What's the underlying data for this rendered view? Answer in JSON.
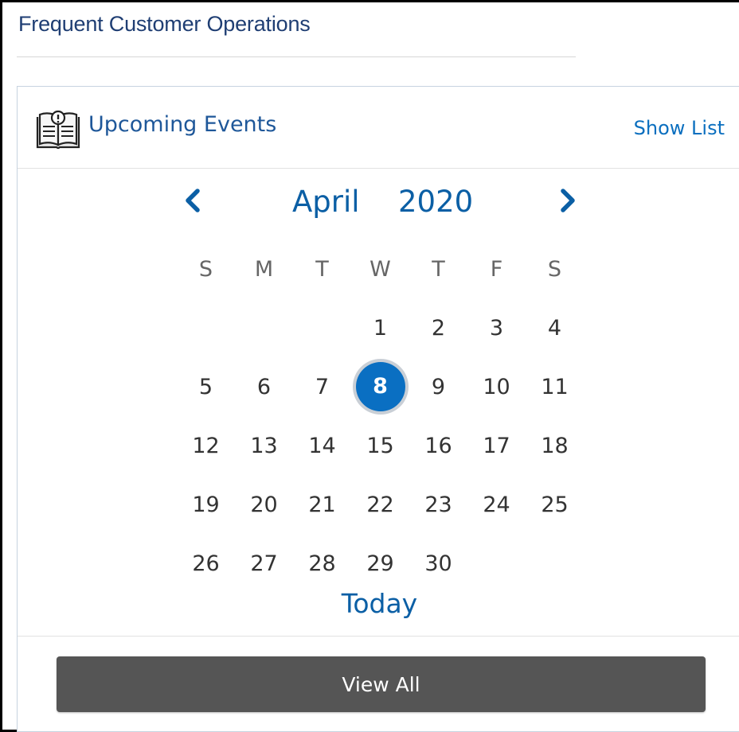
{
  "page": {
    "title": "Frequent Customer Operations"
  },
  "widget": {
    "icon": "book-info-icon",
    "title": "Upcoming Events",
    "show_list_label": "Show List"
  },
  "calendar": {
    "month": "April",
    "year": "2020",
    "prev_icon": "chevron-left-icon",
    "next_icon": "chevron-right-icon",
    "weekdays": [
      "S",
      "M",
      "T",
      "W",
      "T",
      "F",
      "S"
    ],
    "weeks": [
      [
        "",
        "",
        "",
        "1",
        "2",
        "3",
        "4"
      ],
      [
        "5",
        "6",
        "7",
        "8",
        "9",
        "10",
        "11"
      ],
      [
        "12",
        "13",
        "14",
        "15",
        "16",
        "17",
        "18"
      ],
      [
        "19",
        "20",
        "21",
        "22",
        "23",
        "24",
        "25"
      ],
      [
        "26",
        "27",
        "28",
        "29",
        "30",
        "",
        ""
      ]
    ],
    "selected_day": "8",
    "today_label": "Today",
    "accent_color": "#0a6fc2"
  },
  "footer": {
    "view_all_label": "View All"
  }
}
